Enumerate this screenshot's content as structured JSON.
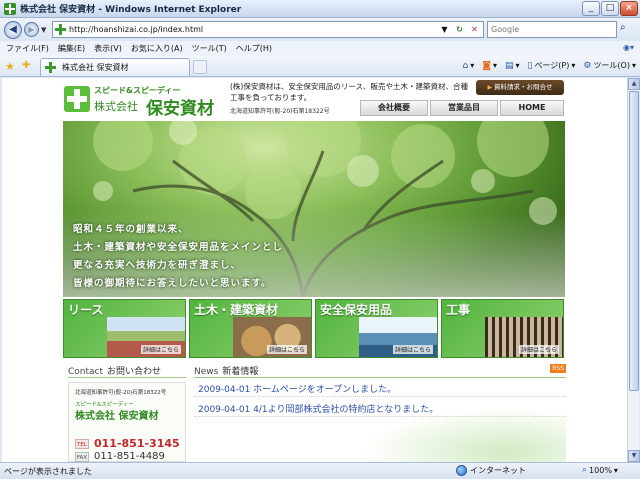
{
  "window": {
    "title": "株式会社 保安資材 - Windows Internet Explorer"
  },
  "address": {
    "url": "http://hoanshizai.co.jp/index.html",
    "search_placeholder": "Google"
  },
  "menu": [
    "ファイル(F)",
    "編集(E)",
    "表示(V)",
    "お気に入り(A)",
    "ツール(T)",
    "ヘルプ(H)"
  ],
  "tab": {
    "label": "株式会社 保安資材"
  },
  "command_bar": {
    "page_label": "ページ(P)",
    "tools_label": "ツール(O)"
  },
  "site": {
    "catch": "スピード&スピーディー",
    "name_prefix": "株式会社",
    "name_main": "保安資材",
    "description": "(株)保安資材は、安全保安用品のリース、販売や土木・建築資材、合種工事を負っております。",
    "license": "北海道知事許可(般-20)石第18322号",
    "request_button": "資料請求・お問合せ",
    "nav": [
      "会社概要",
      "営業品目",
      "HOME"
    ]
  },
  "hero": {
    "lines": [
      "昭和４５年の創業以来、",
      "土木・建築資材や安全保安用品をメインとし",
      "更なる充実へ技術力を研ぎ澄まし、",
      "皆様の御期待にお答えしたいと思います。"
    ]
  },
  "categories": [
    {
      "title": "リース",
      "more": "詳細はこちら"
    },
    {
      "title": "土木・建築資材",
      "more": "詳細はこちら"
    },
    {
      "title": "安全保安用品",
      "more": "詳細はこちら"
    },
    {
      "title": "工事",
      "more": "詳細はこちら"
    }
  ],
  "contact": {
    "head_en": "Contact",
    "head_ja": "お問い合わせ",
    "license": "北海道知事許可(般-20)石第18322号",
    "catch": "スピード&スピーディー",
    "name": "株式会社 保安資材",
    "tel_tag": "TEL",
    "tel": "011-851-3145",
    "fax_tag": "FAX",
    "fax": "011-851-4489"
  },
  "news": {
    "head_en": "News",
    "head_ja": "新着情報",
    "rss": "RSS",
    "items": [
      "2009-04-01 ホームページをオープンしました。",
      "2009-04-01 4/1より岡部株式会社の特約店となりました。"
    ]
  },
  "status": {
    "text": "ページが表示されました",
    "zone": "インターネット",
    "zoom": "100%"
  }
}
